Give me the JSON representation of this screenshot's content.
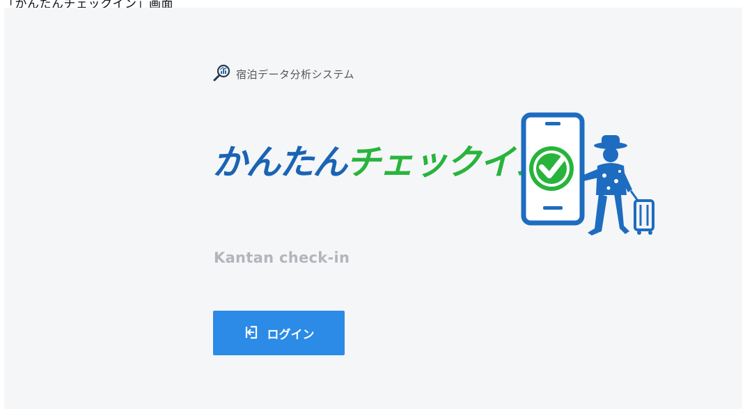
{
  "caption": "「かんたんチェックイン」画面",
  "system_name": "宿泊データ分析システム",
  "logo": {
    "text_blue": "かんたん",
    "text_green": "チェックイン"
  },
  "subtitle": "Kantan check-in",
  "login_button": {
    "label": "ログイン",
    "icon": "login-icon"
  },
  "colors": {
    "brand_blue": "#1a64b4",
    "brand_green": "#28b43c",
    "button_blue": "#2b8be6",
    "subtitle_gray": "#b2b5ba",
    "background": "#f5f6f8"
  }
}
